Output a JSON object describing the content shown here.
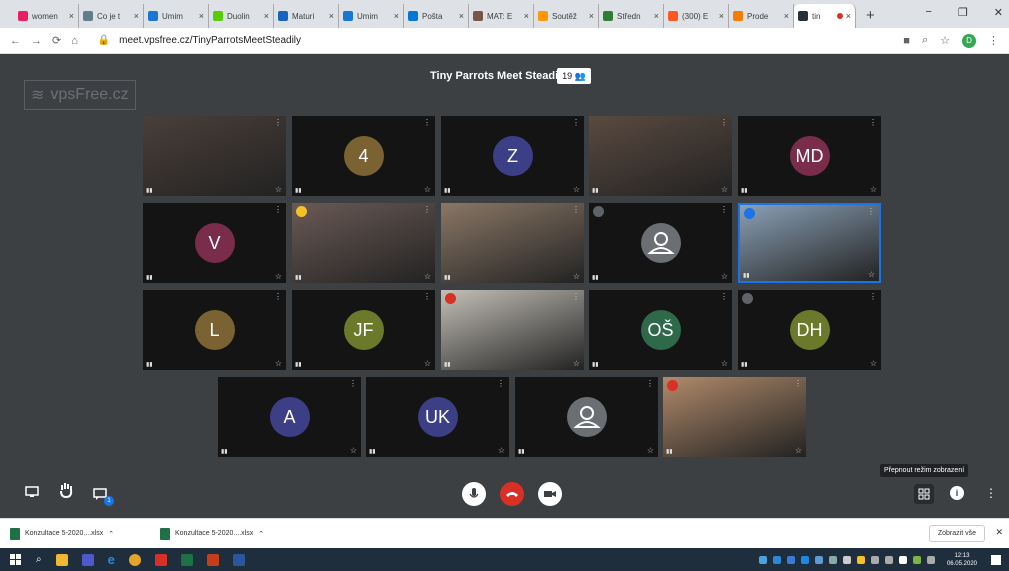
{
  "browser": {
    "tabs": [
      {
        "title": "women",
        "color": "#e91e63"
      },
      {
        "title": "Co je t",
        "color": "#607d8b"
      },
      {
        "title": "Umim",
        "color": "#1976d2"
      },
      {
        "title": "Duolin",
        "color": "#58cc02"
      },
      {
        "title": "Maturi",
        "color": "#1565c0"
      },
      {
        "title": "Umim",
        "color": "#1976d2"
      },
      {
        "title": "Pošta",
        "color": "#0078d4"
      },
      {
        "title": "MAT: E",
        "color": "#795548"
      },
      {
        "title": "Soutěž",
        "color": "#ff9800"
      },
      {
        "title": "Středn",
        "color": "#2e7d32"
      },
      {
        "title": "(300) E",
        "color": "#ff5722"
      },
      {
        "title": "Prode",
        "color": "#f57c00"
      }
    ],
    "active_tab": {
      "title": "tin",
      "color": "#263238"
    },
    "new_tab_label": "+",
    "close_glyph": "×",
    "url": "meet.vpsfree.cz/TinyParrotsMeetSteadily",
    "profile_initial": "D",
    "window_controls": [
      "−",
      "❐",
      "✕"
    ]
  },
  "meet": {
    "logo_text": "vpsFree.cz",
    "title": "Tiny Parrots Meet Steadily",
    "participant_count": "19",
    "more_glyph": "⋮",
    "pin_glyph": "☆",
    "tooltip": "Přepnout režim zobrazení",
    "tiles": [
      {
        "row": 0,
        "col": 0,
        "initials": "",
        "type": "video",
        "bg": "#4a3f3a"
      },
      {
        "row": 0,
        "col": 1,
        "initials": "4",
        "type": "avatar",
        "bg": "#7a6232"
      },
      {
        "row": 0,
        "col": 2,
        "initials": "Z",
        "type": "avatar",
        "bg": "#3c3f86"
      },
      {
        "row": 0,
        "col": 3,
        "initials": "",
        "type": "video",
        "bg": "#5a4a40"
      },
      {
        "row": 0,
        "col": 4,
        "initials": "MD",
        "type": "avatar",
        "bg": "#7a2d4a"
      },
      {
        "row": 1,
        "col": 0,
        "initials": "V",
        "type": "avatar",
        "bg": "#7a2d4a"
      },
      {
        "row": 1,
        "col": 1,
        "initials": "",
        "type": "video",
        "bg": "#6a5a55",
        "badge": "yellow"
      },
      {
        "row": 1,
        "col": 2,
        "initials": "",
        "type": "video",
        "bg": "#8a7766"
      },
      {
        "row": 1,
        "col": 3,
        "initials": "",
        "type": "placeholder",
        "bg": "#555",
        "badge": "grey"
      },
      {
        "row": 1,
        "col": 4,
        "initials": "",
        "type": "video",
        "bg": "#8aa0b5",
        "badge": "blue",
        "speaking": true
      },
      {
        "row": 2,
        "col": 0,
        "initials": "L",
        "type": "avatar",
        "bg": "#7a6232"
      },
      {
        "row": 2,
        "col": 1,
        "initials": "JF",
        "type": "avatar",
        "bg": "#6a7a2a"
      },
      {
        "row": 2,
        "col": 2,
        "initials": "",
        "type": "video",
        "bg": "#c4c0b8",
        "badge": "red"
      },
      {
        "row": 2,
        "col": 3,
        "initials": "OŠ",
        "type": "avatar",
        "bg": "#2e6a4a"
      },
      {
        "row": 2,
        "col": 4,
        "initials": "DH",
        "type": "avatar",
        "bg": "#6a7a2a",
        "badge": "grey"
      },
      {
        "row": 3,
        "col": 0,
        "initials": "A",
        "type": "avatar",
        "bg": "#3c3f86"
      },
      {
        "row": 3,
        "col": 1,
        "initials": "UK",
        "type": "avatar",
        "bg": "#3c3f86"
      },
      {
        "row": 3,
        "col": 2,
        "initials": "",
        "type": "placeholder",
        "bg": "#555"
      },
      {
        "row": 3,
        "col": 3,
        "initials": "",
        "type": "video",
        "bg": "#b08a6a",
        "badge": "red"
      }
    ]
  },
  "downloads": {
    "items": [
      "Konzultace 5-2020....xlsx",
      "Konzultace 5-2020....xlsx"
    ],
    "show_all": "Zobrazit vše"
  },
  "taskbar": {
    "time": "12:13",
    "date": "06.05.2020"
  }
}
